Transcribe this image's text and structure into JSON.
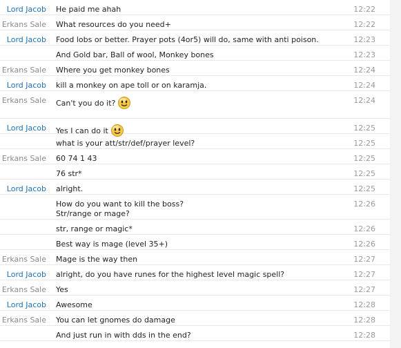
{
  "messages": [
    {
      "sender": "Lord Jacob",
      "text": [
        "He paid me ahah"
      ],
      "time": "12:22"
    },
    {
      "sender": "Erkans Sale",
      "text": [
        "What resources do you need+"
      ],
      "time": "12:22"
    },
    {
      "sender": "Lord Jacob",
      "text": [
        "Food lobs or better. Prayer pots (4or5) will do, same with anti poison."
      ],
      "time": "12:23"
    },
    {
      "sender": "",
      "text": [
        "And Gold bar, Ball of wool, Monkey bones"
      ],
      "time": "12:23"
    },
    {
      "sender": "Erkans Sale",
      "text": [
        "Where you get monkey bones"
      ],
      "time": "12:24"
    },
    {
      "sender": "Lord Jacob",
      "text": [
        "kill a monkey on ape toll or on karamja."
      ],
      "time": "12:24"
    },
    {
      "sender": "Erkans Sale",
      "text": [
        "Can't you do it?"
      ],
      "emoticon": "smiley-icon",
      "time": "12:24"
    },
    {
      "sender": "Lord Jacob",
      "text": [
        "Yes I can do it"
      ],
      "emoticon": "smiley-icon",
      "time": "12:25"
    },
    {
      "sender": "",
      "text": [
        "what is your att/str/def/prayer level?"
      ],
      "time": "12:25"
    },
    {
      "sender": "Erkans Sale",
      "text": [
        "60 74 1 43"
      ],
      "time": "12:25"
    },
    {
      "sender": "",
      "text": [
        "76 str*"
      ],
      "time": "12:25"
    },
    {
      "sender": "Lord Jacob",
      "text": [
        "alright."
      ],
      "time": "12:25"
    },
    {
      "sender": "",
      "text": [
        "How do you want to kill the boss?",
        "Str/range or mage?"
      ],
      "time": "12:26"
    },
    {
      "sender": "",
      "text": [
        "str, range or magic*"
      ],
      "time": "12:26"
    },
    {
      "sender": "",
      "text": [
        "Best way is mage (level 35+)"
      ],
      "time": "12:26"
    },
    {
      "sender": "Erkans Sale",
      "text": [
        "Mage is the way then"
      ],
      "time": "12:27"
    },
    {
      "sender": "Lord Jacob",
      "text": [
        "alright, do you have runes for the highest level magic spell?"
      ],
      "time": "12:27"
    },
    {
      "sender": "Erkans Sale",
      "text": [
        "Yes"
      ],
      "time": "12:27"
    },
    {
      "sender": "Lord Jacob",
      "text": [
        "Awesome"
      ],
      "time": "12:28"
    },
    {
      "sender": "Erkans Sale",
      "text": [
        "You can let gnomes do damage"
      ],
      "time": "12:28"
    },
    {
      "sender": "",
      "text": [
        "And just run in with dds in the end?"
      ],
      "time": "12:28"
    }
  ],
  "colors": {
    "lord_jacob": "#1e6fb8",
    "erkans_sale": "#8a8a8a",
    "message_text": "#222222",
    "time": "#9a9a9a",
    "divider": "#e9e9e9"
  }
}
